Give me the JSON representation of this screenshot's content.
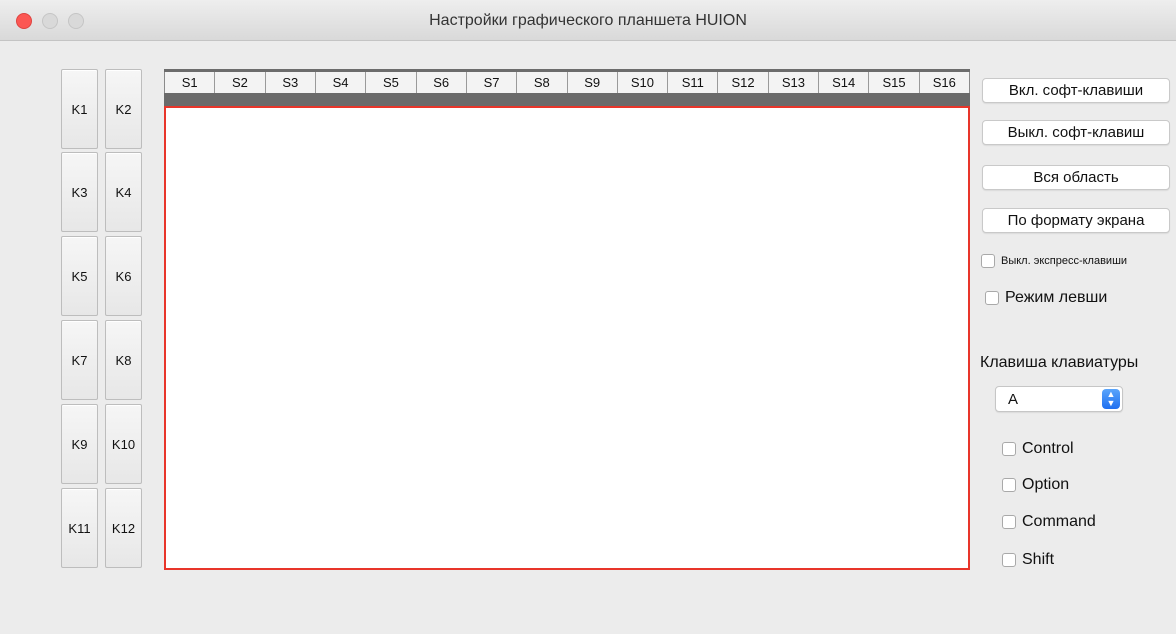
{
  "window": {
    "title": "Настройки графического планшета HUION"
  },
  "express_keys": [
    {
      "label": "K1"
    },
    {
      "label": "K2"
    },
    {
      "label": "K3"
    },
    {
      "label": "K4"
    },
    {
      "label": "K5"
    },
    {
      "label": "K6"
    },
    {
      "label": "K7"
    },
    {
      "label": "K8"
    },
    {
      "label": "K9"
    },
    {
      "label": "K10"
    },
    {
      "label": "K11"
    },
    {
      "label": "K12"
    }
  ],
  "soft_key_tabs": [
    {
      "label": "S1"
    },
    {
      "label": "S2"
    },
    {
      "label": "S3"
    },
    {
      "label": "S4"
    },
    {
      "label": "S5"
    },
    {
      "label": "S6"
    },
    {
      "label": "S7"
    },
    {
      "label": "S8"
    },
    {
      "label": "S9"
    },
    {
      "label": "S10"
    },
    {
      "label": "S11"
    },
    {
      "label": "S12"
    },
    {
      "label": "S13"
    },
    {
      "label": "S14"
    },
    {
      "label": "S15"
    },
    {
      "label": "S16"
    }
  ],
  "actions": {
    "enable_soft_keys": "Вкл. софт-клавиши",
    "disable_soft_keys": "Выкл. софт-клавиш",
    "full_area": "Вся область",
    "screen_format": "По формату экрана"
  },
  "options": {
    "disable_express_keys": "Выкл. экспресс-клавиши",
    "left_hand_mode": "Режим левши"
  },
  "keyboard": {
    "label": "Клавиша клавиатуры",
    "selected_key": "A",
    "modifiers": {
      "control": "Control",
      "option": "Option",
      "command": "Command",
      "shift": "Shift"
    }
  },
  "colors": {
    "close_button": "#fc5753",
    "active_area_border": "#e8352a",
    "select_arrow": "#1f6ff0"
  }
}
